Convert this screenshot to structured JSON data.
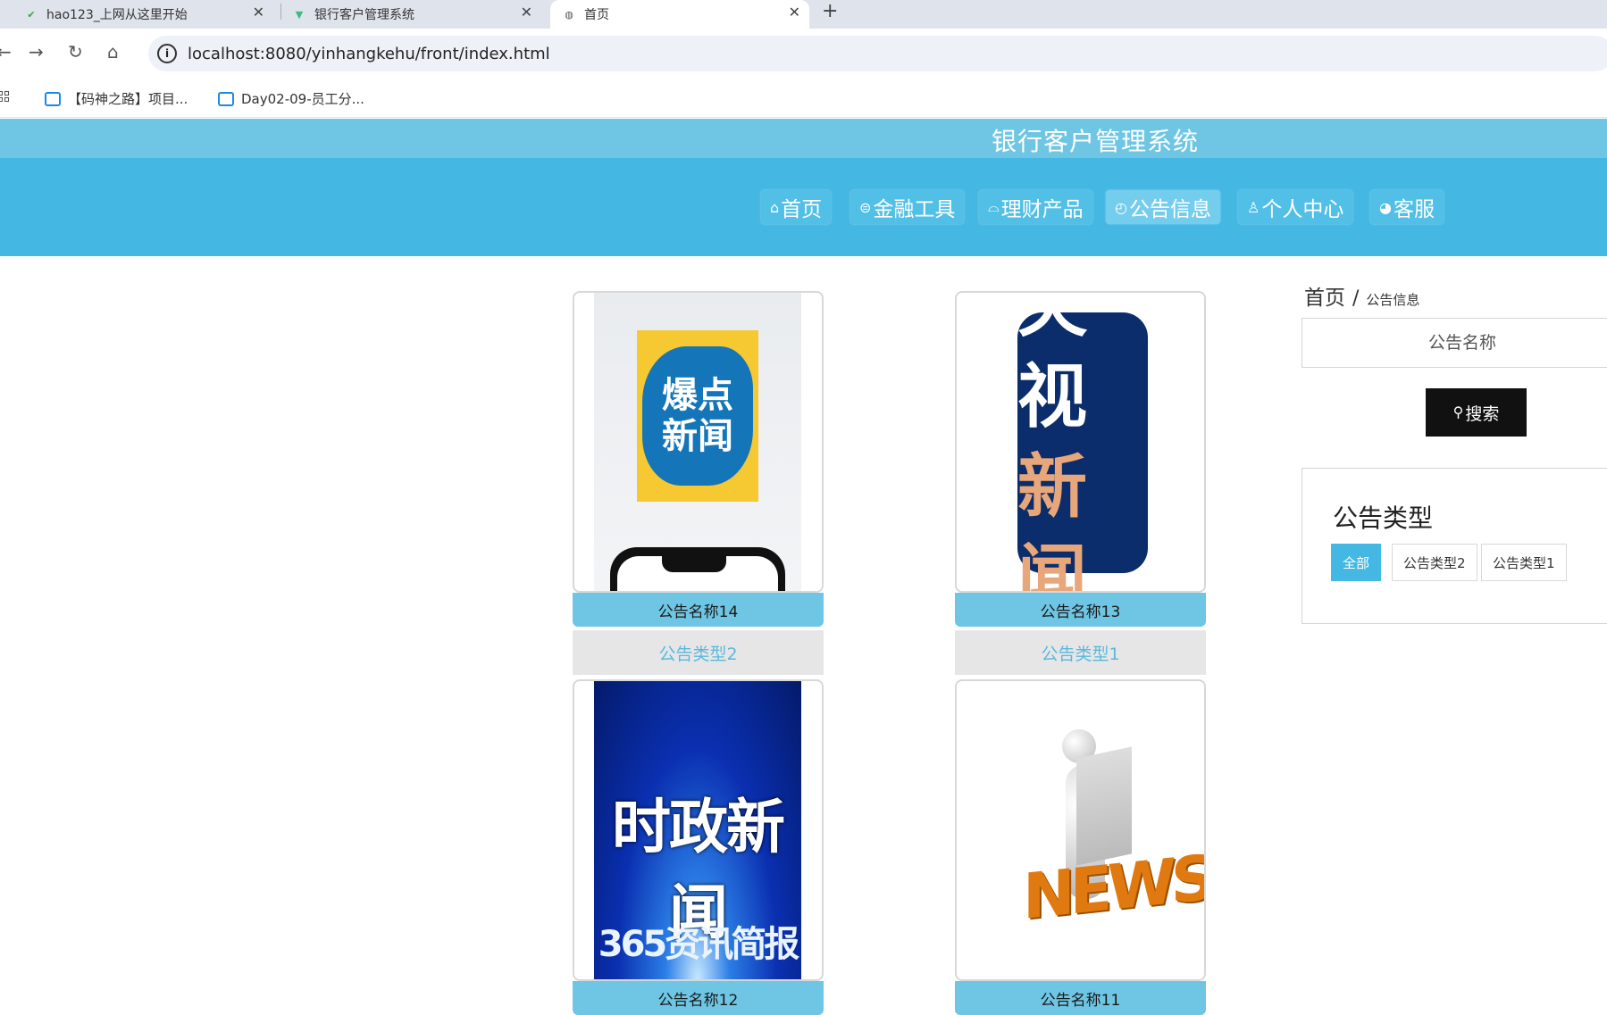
{
  "browser": {
    "tabs": [
      {
        "title": "hao123_上网从这里开始",
        "icon": "hao123-favicon"
      },
      {
        "title": "银行客户管理系统",
        "icon": "vue-favicon"
      },
      {
        "title": "首页",
        "icon": "globe-icon",
        "active": true
      }
    ],
    "url": "localhost:8080/yinhangkehu/front/index.html",
    "bookmarks": [
      {
        "label": "【码神之路】项目..."
      },
      {
        "label": "Day02-09-员工分..."
      }
    ]
  },
  "site": {
    "title": "银行客户管理系统",
    "nav": [
      {
        "label": "首页",
        "icon": "home-icon"
      },
      {
        "label": "金融工具",
        "icon": "finance-icon"
      },
      {
        "label": "理财产品",
        "icon": "product-icon"
      },
      {
        "label": "公告信息",
        "icon": "notice-icon",
        "active": true
      },
      {
        "label": "个人中心",
        "icon": "user-icon"
      },
      {
        "label": "客服",
        "icon": "service-icon"
      }
    ]
  },
  "cards": [
    {
      "name": "公告名称14",
      "type": "公告类型2",
      "image_text": [
        "爆点",
        "新闻"
      ]
    },
    {
      "name": "公告名称13",
      "type": "公告类型1",
      "image_text": [
        "央视",
        "新闻"
      ]
    },
    {
      "name": "公告名称12",
      "image_text": [
        "时政新闻",
        "365资讯简报"
      ]
    },
    {
      "name": "公告名称11",
      "image_text": [
        "NEWS"
      ]
    }
  ],
  "sidebar": {
    "breadcrumb": {
      "home": "首页",
      "separator": "/",
      "current": "公告信息"
    },
    "search": {
      "placeholder": "公告名称",
      "button_label": "搜索"
    },
    "types": {
      "title": "公告类型",
      "options": [
        {
          "label": "全部",
          "active": true
        },
        {
          "label": "公告类型2"
        },
        {
          "label": "公告类型1"
        }
      ]
    }
  }
}
